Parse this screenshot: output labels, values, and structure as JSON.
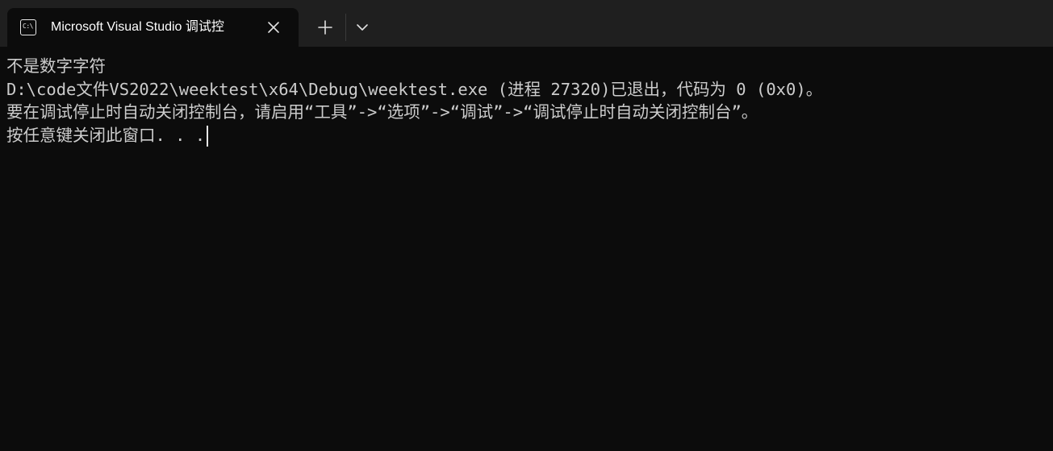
{
  "window": {
    "tab": {
      "icon": "terminal-cmd-icon",
      "icon_text": "C:\\",
      "title": "Microsoft Visual Studio 调试控"
    },
    "buttons": {
      "close_icon": "close-icon",
      "new_tab_icon": "plus-icon",
      "dropdown_icon": "chevron-down-icon"
    }
  },
  "terminal": {
    "lines": [
      "不是数字字符",
      "D:\\code文件VS2022\\weektest\\x64\\Debug\\weektest.exe (进程 27320)已退出，代码为 0 (0x0)。",
      "要在调试停止时自动关闭控制台，请启用“工具”->“选项”->“调试”->“调试停止时自动关闭控制台”。",
      "按任意键关闭此窗口. . ."
    ]
  },
  "colors": {
    "background": "#0c0c0c",
    "tabbar": "#1f1f1f",
    "text": "#cccccc"
  }
}
